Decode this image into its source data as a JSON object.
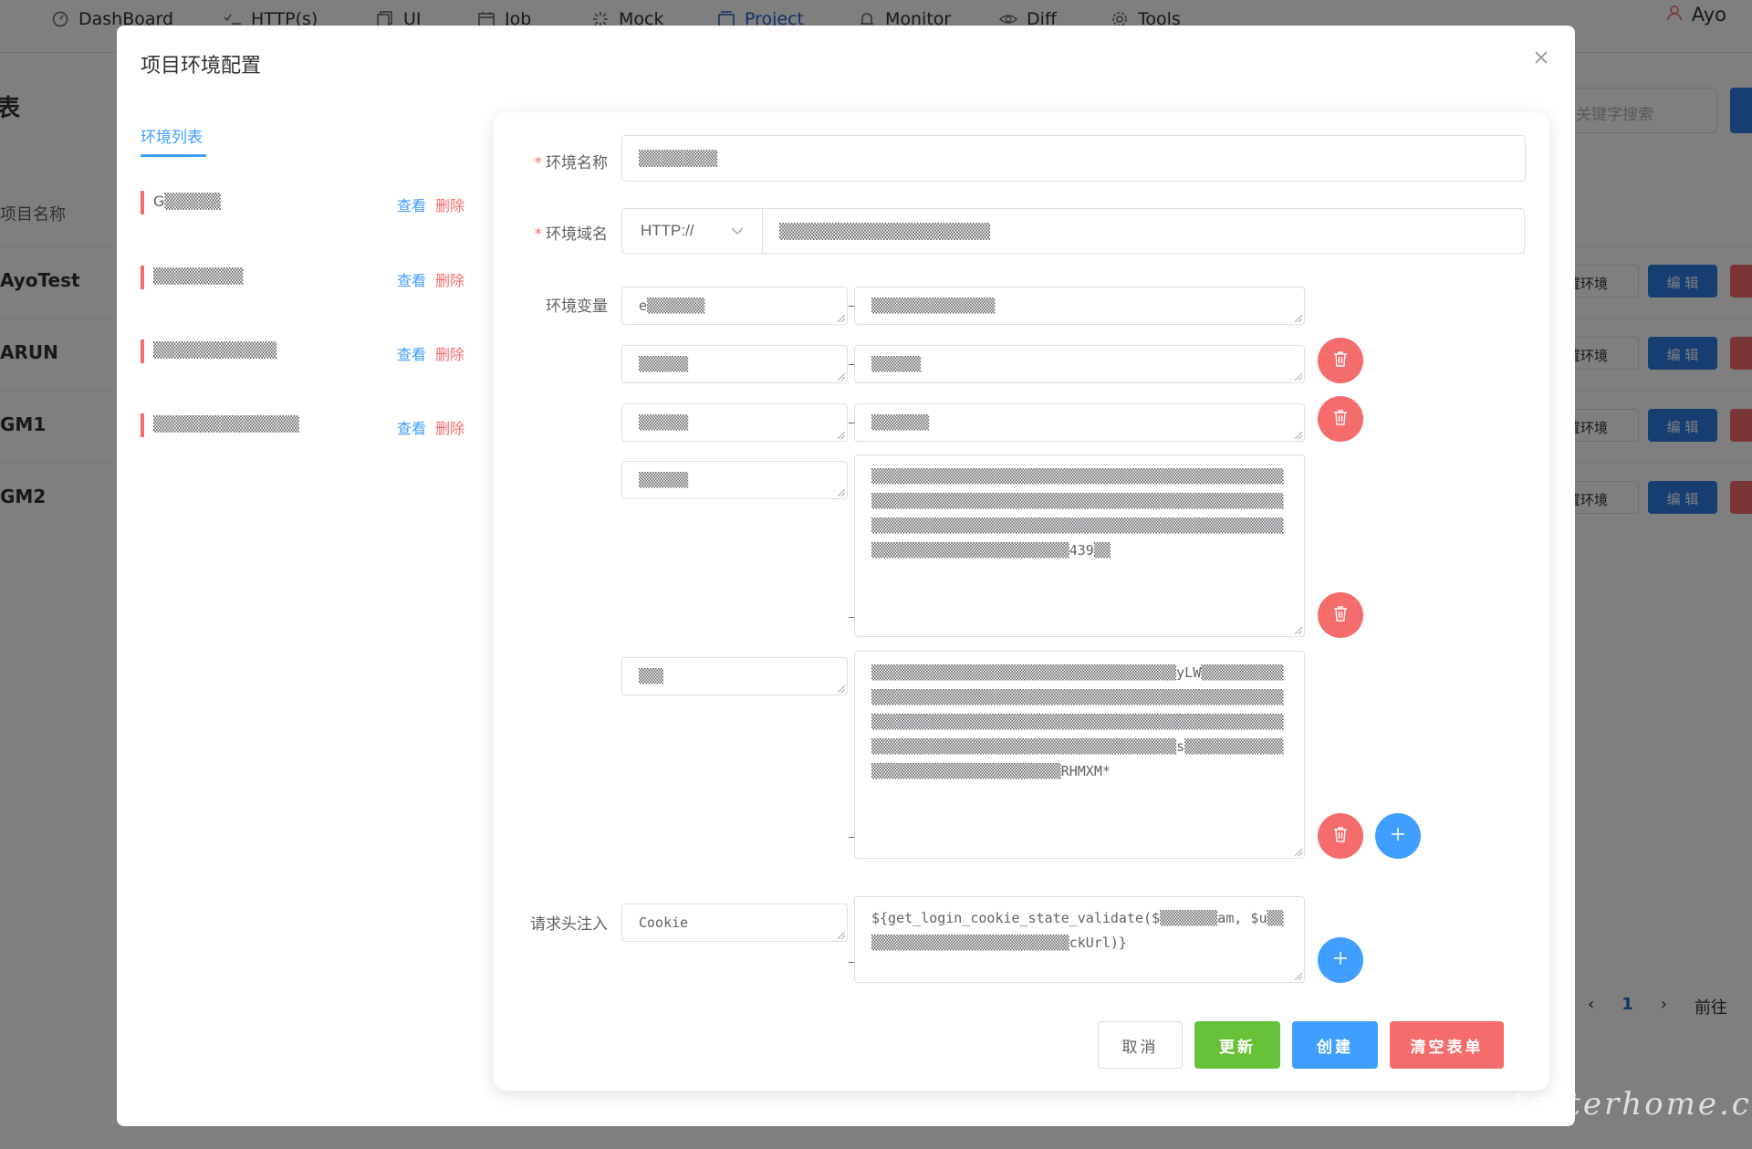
{
  "topnav": {
    "items": [
      {
        "label": "DashBoard",
        "icon": "gauge-icon"
      },
      {
        "label": "HTTP(s)",
        "icon": "checklist-icon"
      },
      {
        "label": "UI",
        "icon": "copy-icon"
      },
      {
        "label": "Job",
        "icon": "calendar-icon"
      },
      {
        "label": "Mock",
        "icon": "spinner-icon"
      },
      {
        "label": "Project",
        "icon": "folder-icon",
        "active": true
      },
      {
        "label": "Monitor",
        "icon": "bell-icon"
      },
      {
        "label": "Diff",
        "icon": "eye-icon"
      },
      {
        "label": "Tools",
        "icon": "gear-icon"
      }
    ],
    "user": "Ayo"
  },
  "background": {
    "title": "表",
    "search_placeholder": "关键字搜索",
    "column_header": "项目名称",
    "rows": [
      {
        "name": "AyoTest",
        "env_button": "置环境",
        "edit_button": "编 辑"
      },
      {
        "name": "ARUN",
        "env_button": "置环境",
        "edit_button": "编 辑"
      },
      {
        "name": "GM1",
        "env_button": "置环境",
        "edit_button": "编 辑"
      },
      {
        "name": "GM2",
        "env_button": "置环境",
        "edit_button": "编 辑"
      }
    ],
    "pager": {
      "current": "1",
      "goto_label": "前往"
    }
  },
  "dialog": {
    "title": "项目环境配置",
    "tab_label": "环境列表",
    "env_list": [
      {
        "name": "G▒▒▒▒▒",
        "view": "查看",
        "delete": "删除"
      },
      {
        "name": "▒▒▒▒▒▒▒▒",
        "view": "查看",
        "delete": "删除"
      },
      {
        "name": "▒▒▒▒▒▒▒▒▒▒▒",
        "view": "查看",
        "delete": "删除"
      },
      {
        "name": "▒▒▒▒▒▒▒▒▒▒▒▒▒",
        "view": "查看",
        "delete": "删除"
      }
    ]
  },
  "form": {
    "env_name_label": "环境名称",
    "env_name_value": "▒▒▒▒▒▒▒",
    "env_domain_label": "环境域名",
    "protocol_value": "HTTP://",
    "domain_value": "▒▒▒▒▒▒▒▒▒▒▒▒▒▒▒▒▒▒▒▒▒▒▒▒",
    "env_vars_label": "环境变量",
    "env_vars": [
      {
        "key": "e▒▒▒▒▒▒▒",
        "value": "▒▒▒▒▒▒▒▒▒▒▒▒▒▒▒"
      },
      {
        "key": "▒▒▒▒▒▒",
        "value": "▒▒▒▒▒▒"
      },
      {
        "key": "▒▒▒▒▒▒",
        "value": "▒▒▒▒▒▒▒"
      },
      {
        "key": "▒▒▒▒▒▒",
        "value": "▒▒▒▒▒▒▒▒▒▒▒▒▒▒▒▒▒▒▒▒▒▒▒▒▒▒▒▒▒▒▒▒▒▒▒▒▒▒▒▒▒▒▒▒▒▒▒▒▒▒▒▒▒▒▒▒▒▒▒▒▒▒▒▒▒▒▒▒▒▒▒▒▒▒▒▒▒▒▒▒▒▒▒▒▒▒▒▒▒▒▒▒▒▒▒▒▒▒▒▒▒▒▒▒▒▒▒▒▒▒▒▒▒▒▒▒▒▒▒▒▒▒▒▒▒▒▒▒▒▒▒▒▒▒▒▒▒▒▒▒▒▒▒▒▒▒▒▒▒▒▒▒▒▒▒▒▒▒▒▒▒▒▒▒▒▒▒▒▒▒▒▒▒▒439▒▒"
      },
      {
        "key": "▒▒▒",
        "value": "▒▒▒▒▒▒▒▒▒▒▒▒▒▒▒▒▒▒▒▒▒▒▒▒▒▒▒▒▒▒▒▒▒▒▒▒▒yLW▒▒▒▒▒▒▒▒▒▒▒▒▒▒▒▒▒▒▒▒▒▒▒▒▒▒▒▒▒▒▒▒▒▒▒▒▒▒▒▒▒▒▒▒▒▒▒▒▒▒▒▒▒▒▒▒▒▒▒▒▒▒▒▒▒▒▒▒▒▒▒▒▒▒▒▒▒▒▒▒▒▒▒▒▒▒▒▒▒▒▒▒▒▒▒▒▒▒▒▒▒▒▒▒▒▒▒▒▒▒▒▒▒▒▒▒▒▒▒▒▒▒▒▒▒▒▒▒▒▒▒▒▒▒▒▒▒▒▒▒▒▒▒▒▒▒▒s▒▒▒▒▒▒▒▒▒▒▒▒▒▒▒▒▒▒▒▒▒▒▒▒▒▒▒▒▒▒▒▒▒▒▒RHMXM*"
      }
    ],
    "header_inject_label": "请求头注入",
    "header_key": "Cookie",
    "header_value": "${get_login_cookie_state_validate($▒▒▒▒▒▒▒am, $u▒▒▒▒▒▒▒▒▒▒▒▒▒▒▒▒▒▒▒▒▒▒▒▒▒▒ckUrl)}",
    "buttons": {
      "cancel": "取消",
      "update": "更新",
      "create": "创建",
      "clear": "清空表单"
    }
  },
  "watermark": "testerhome.com",
  "colors": {
    "primary": "#409eff",
    "danger": "#f56c6c",
    "success": "#67c23a"
  }
}
